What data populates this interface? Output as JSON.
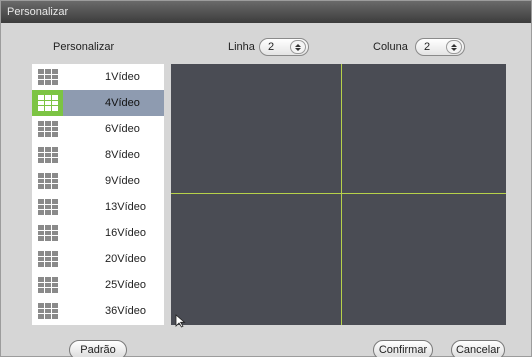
{
  "window": {
    "title": "Personalizar"
  },
  "left_header": "Personalizar",
  "rows": {
    "label": "Linha",
    "value": "2"
  },
  "cols": {
    "label": "Coluna",
    "value": "2"
  },
  "layouts": [
    {
      "label": "1Vídeo",
      "selected": false
    },
    {
      "label": "4Vídeo",
      "selected": true
    },
    {
      "label": "6Vídeo",
      "selected": false
    },
    {
      "label": "8Vídeo",
      "selected": false
    },
    {
      "label": "9Vídeo",
      "selected": false
    },
    {
      "label": "13Vídeo",
      "selected": false
    },
    {
      "label": "16Vídeo",
      "selected": false
    },
    {
      "label": "20Vídeo",
      "selected": false
    },
    {
      "label": "25Vídeo",
      "selected": false
    },
    {
      "label": "36Vídeo",
      "selected": false
    }
  ],
  "buttons": {
    "default": "Padrão",
    "confirm": "Confirmar",
    "cancel": "Cancelar"
  },
  "colors": {
    "selected_icon_bg": "#7cc443",
    "selected_row_bg": "#8e9bb0",
    "preview_bg": "#4a4c54",
    "grid_line": "#b7d14a"
  }
}
